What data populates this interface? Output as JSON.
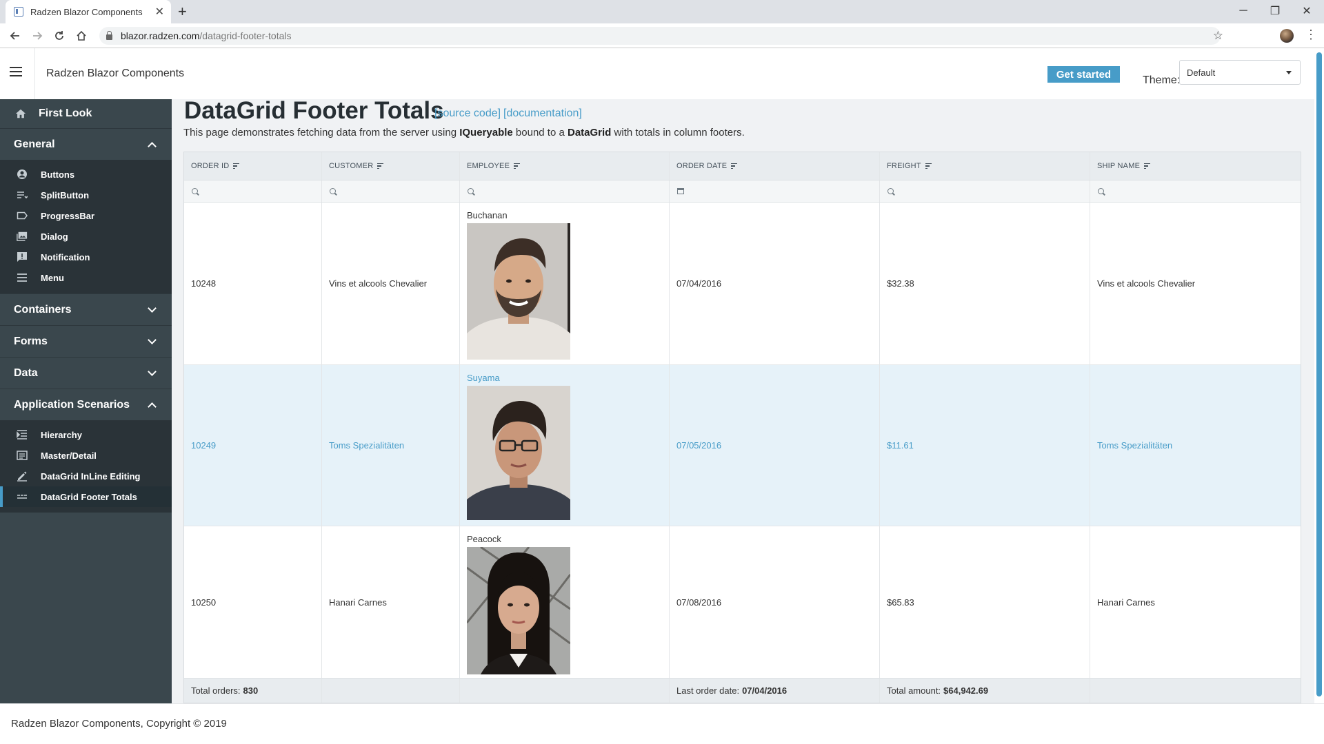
{
  "browser": {
    "tab_title": "Radzen Blazor Components",
    "new_tab_label": "+",
    "url_host": "blazor.radzen.com",
    "url_path": "/datagrid-footer-totals"
  },
  "header": {
    "brand": "Radzen Blazor Components",
    "get_started_label": "Get started",
    "theme_label": "Theme:",
    "theme_value": "Default"
  },
  "sidebar": {
    "first_look": "First Look",
    "sections": [
      {
        "label": "General",
        "expanded": true
      },
      {
        "label": "Containers",
        "expanded": false
      },
      {
        "label": "Forms",
        "expanded": false
      },
      {
        "label": "Data",
        "expanded": false
      },
      {
        "label": "Application Scenarios",
        "expanded": true
      }
    ],
    "general_items": [
      {
        "label": "Buttons",
        "icon": "account-circle-icon"
      },
      {
        "label": "SplitButton",
        "icon": "list-icon"
      },
      {
        "label": "ProgressBar",
        "icon": "label-icon"
      },
      {
        "label": "Dialog",
        "icon": "image-icon"
      },
      {
        "label": "Notification",
        "icon": "announcement-icon"
      },
      {
        "label": "Menu",
        "icon": "menu-icon"
      }
    ],
    "scenario_items": [
      {
        "label": "Hierarchy",
        "icon": "hierarchy-icon"
      },
      {
        "label": "Master/Detail",
        "icon": "detail-icon"
      },
      {
        "label": "DataGrid InLine Editing",
        "icon": "edit-icon"
      },
      {
        "label": "DataGrid Footer Totals",
        "icon": "footer-icon",
        "active": true
      }
    ]
  },
  "page": {
    "title": "DataGrid Footer Totals",
    "source_link": "[source code]",
    "docs_link": "[documentation]",
    "desc_before": "This page demonstrates fetching data from the server using ",
    "desc_b1": "IQueryable",
    "desc_mid": " bound to a ",
    "desc_b2": "DataGrid",
    "desc_after": " with totals in column footers."
  },
  "grid": {
    "columns": [
      "ORDER ID",
      "CUSTOMER",
      "EMPLOYEE",
      "ORDER DATE",
      "FREIGHT",
      "SHIP NAME"
    ],
    "rows": [
      {
        "order_id": "10248",
        "customer": "Vins et alcools Chevalier",
        "employee": "Buchanan",
        "order_date": "07/04/2016",
        "freight": "$32.38",
        "ship_name": "Vins et alcools Chevalier"
      },
      {
        "order_id": "10249",
        "customer": "Toms Spezialitäten",
        "employee": "Suyama",
        "order_date": "07/05/2016",
        "freight": "$11.61",
        "ship_name": "Toms Spezialitäten"
      },
      {
        "order_id": "10250",
        "customer": "Hanari Carnes",
        "employee": "Peacock",
        "order_date": "07/08/2016",
        "freight": "$65.83",
        "ship_name": "Hanari Carnes"
      }
    ],
    "footer": {
      "total_orders_label": "Total orders:",
      "total_orders_value": "830",
      "last_order_label": "Last order date:",
      "last_order_value": "07/04/2016",
      "total_amount_label": "Total amount:",
      "total_amount_value": "$64,942.69"
    }
  },
  "footer": {
    "copyright": "Radzen Blazor Components, Copyright © 2019"
  },
  "colors": {
    "accent": "#479cc8",
    "sidebar": "#3a474d",
    "sidebar_sub": "#2a3338",
    "row_highlight": "#e6f2f9"
  }
}
